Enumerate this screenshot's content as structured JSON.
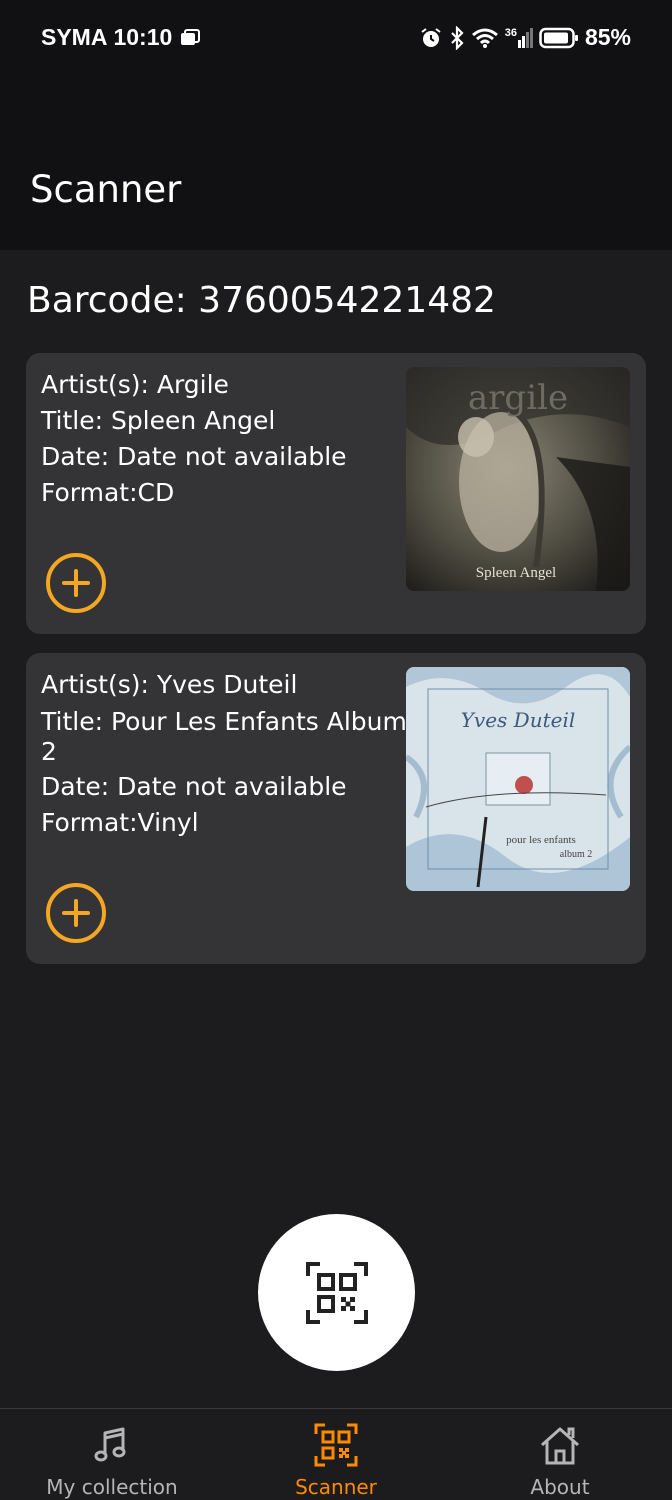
{
  "status": {
    "carrier": "SYMA",
    "time": "10:10",
    "network": "36",
    "battery": "85%"
  },
  "header": {
    "title": "Scanner"
  },
  "barcode": {
    "label": "Barcode: 3760054221482"
  },
  "results": [
    {
      "artist": "Artist(s): Argile",
      "title": "Title: Spleen Angel",
      "date": "Date: Date not available",
      "format": "Format:CD",
      "cover_text": "Spleen Angel",
      "cover_logo": "argile"
    },
    {
      "artist": "Artist(s): Yves Duteil",
      "title_line1": "Title: Pour Les Enfants Album",
      "title_line2": "2",
      "date": "Date: Date not available",
      "format": "Format:Vinyl",
      "cover_logo": "Yves Duteil",
      "cover_text1": "pour les enfants",
      "cover_text2": "album 2"
    }
  ],
  "nav": {
    "items": [
      {
        "label": "My collection",
        "icon": "music-note-icon"
      },
      {
        "label": "Scanner",
        "icon": "qr-scan-icon"
      },
      {
        "label": "About",
        "icon": "home-icon"
      }
    ]
  },
  "colors": {
    "accent": "#f5a623",
    "active_tab": "#ff8a00",
    "card_bg": "#343437",
    "page_bg": "#1c1c1e"
  }
}
